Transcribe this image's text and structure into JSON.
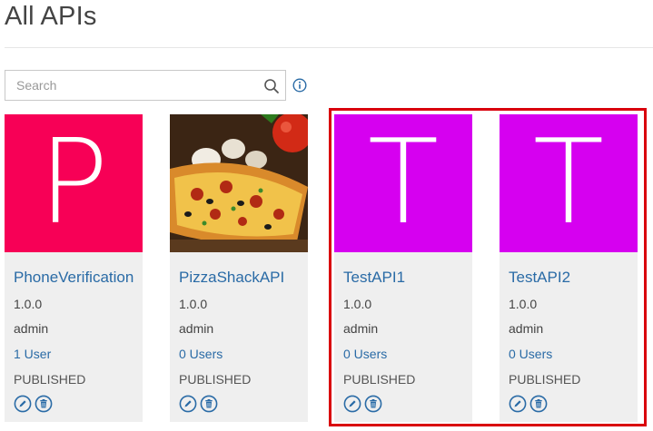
{
  "page": {
    "title": "All APIs"
  },
  "search": {
    "placeholder": "Search",
    "value": ""
  },
  "icons": {
    "search": "search-icon",
    "info": "info-icon",
    "edit": "edit-icon",
    "delete": "delete-icon"
  },
  "colors": {
    "link": "#2a6ba6",
    "tile_pink": "#f70056",
    "tile_purple": "#d600f0",
    "highlight": "#d9000d"
  },
  "apis": [
    {
      "name": "PhoneVerification",
      "version": "1.0.0",
      "owner": "admin",
      "users": "1 User",
      "status": "PUBLISHED",
      "thumb_letter": "P",
      "thumb_color": "#f70056"
    },
    {
      "name": "PizzaShackAPI",
      "version": "1.0.0",
      "owner": "admin",
      "users": "0 Users",
      "status": "PUBLISHED",
      "thumb_letter": "",
      "thumb_color": ""
    },
    {
      "name": "TestAPI1",
      "version": "1.0.0",
      "owner": "admin",
      "users": "0 Users",
      "status": "PUBLISHED",
      "thumb_letter": "T",
      "thumb_color": "#d600f0"
    },
    {
      "name": "TestAPI2",
      "version": "1.0.0",
      "owner": "admin",
      "users": "0 Users",
      "status": "PUBLISHED",
      "thumb_letter": "T",
      "thumb_color": "#d600f0"
    }
  ]
}
